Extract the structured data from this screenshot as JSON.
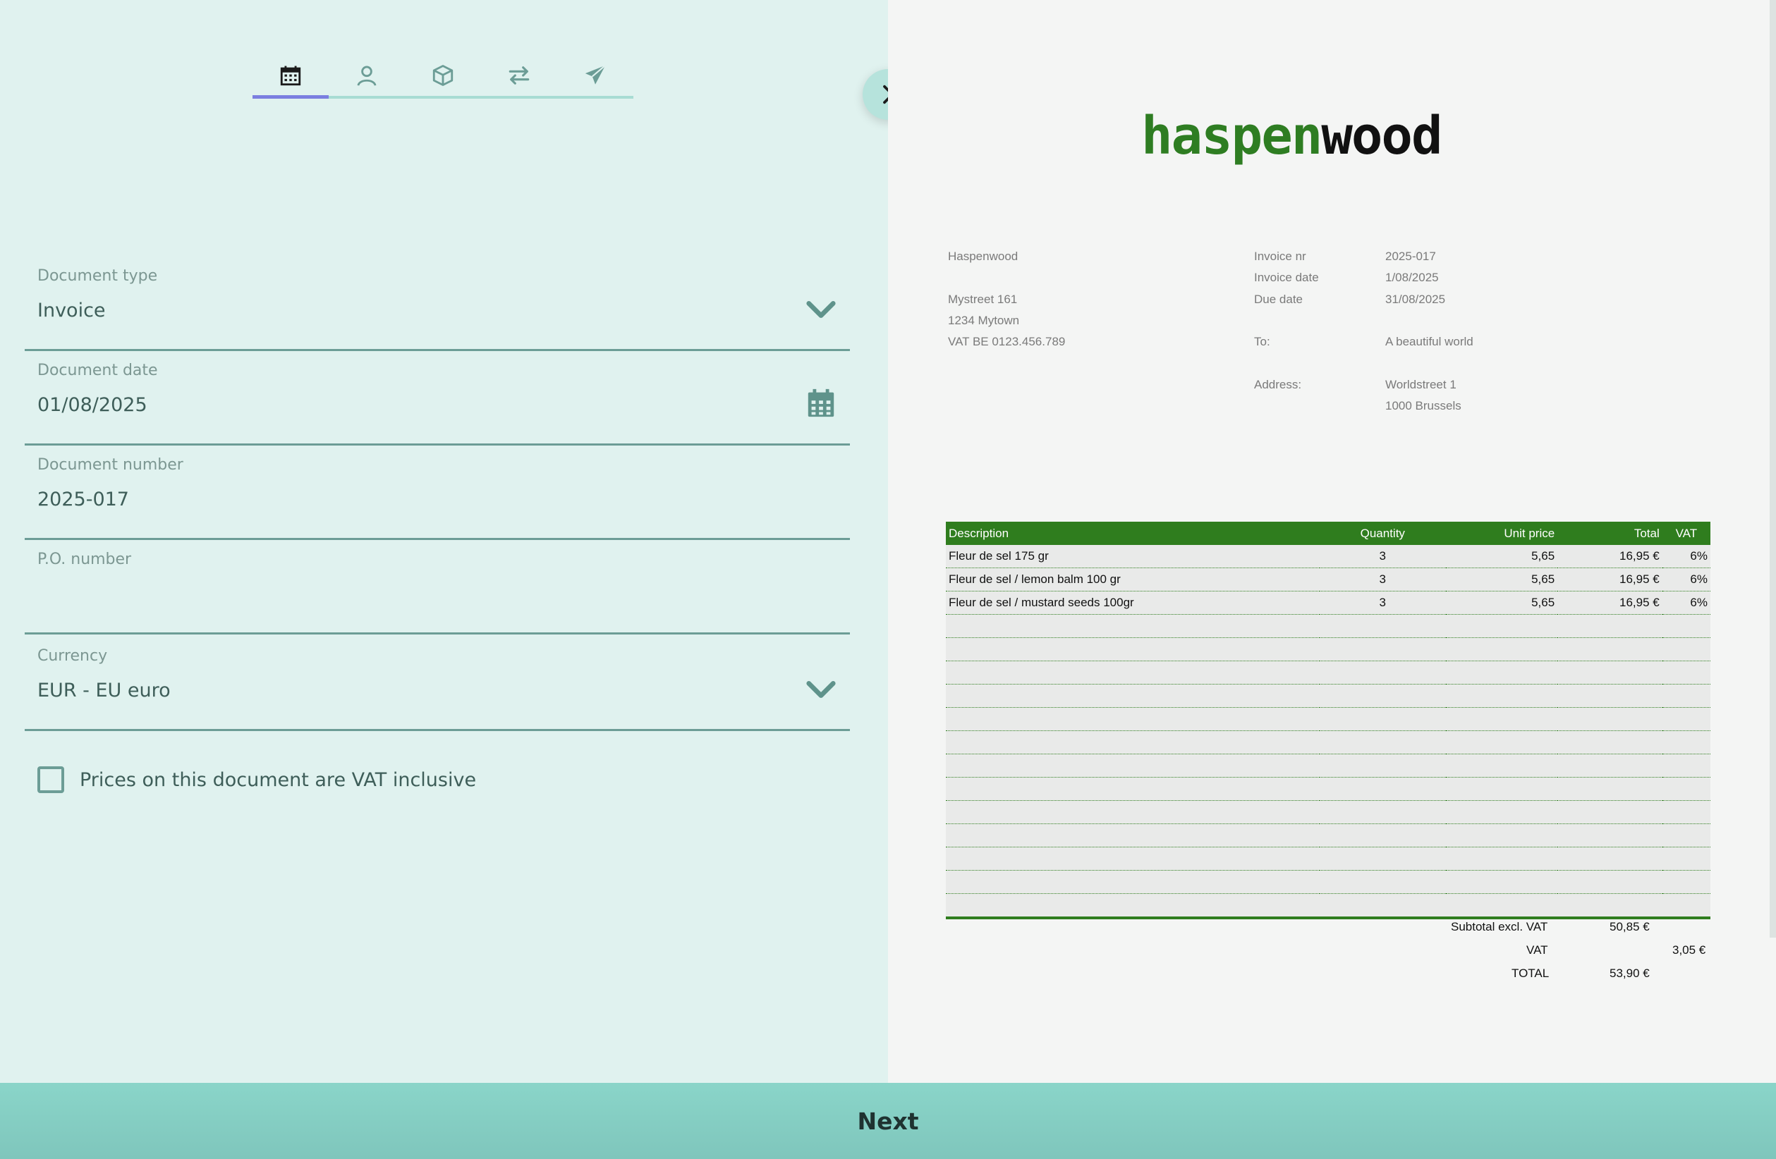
{
  "tabs": [
    {
      "name": "document",
      "icon": "calendar-icon"
    },
    {
      "name": "customer",
      "icon": "user-icon"
    },
    {
      "name": "products",
      "icon": "box-icon"
    },
    {
      "name": "transfer",
      "icon": "swap-icon"
    },
    {
      "name": "send",
      "icon": "paper-plane-icon"
    }
  ],
  "form": {
    "document_type": {
      "label": "Document type",
      "value": "Invoice"
    },
    "document_date": {
      "label": "Document date",
      "value": "01/08/2025"
    },
    "document_number": {
      "label": "Document number",
      "value": "2025-017"
    },
    "po_number": {
      "label": "P.O. number",
      "value": ""
    },
    "currency": {
      "label": "Currency",
      "value": "EUR - EU euro"
    },
    "vat_inclusive": {
      "label": "Prices on this document are VAT inclusive",
      "checked": false
    }
  },
  "preview": {
    "logo": {
      "part1": "haspen",
      "part2": "wood"
    },
    "company": {
      "name": "Haspenwood",
      "street": "Mystreet 161",
      "city": "1234 Mytown",
      "vat": "VAT BE 0123.456.789"
    },
    "invoice": {
      "nr_label": "Invoice nr",
      "nr": "2025-017",
      "date_label": "Invoice date",
      "date": "1/08/2025",
      "due_label": "Due date",
      "due": "31/08/2025",
      "to_label": "To:",
      "to": "A beautiful world",
      "address_label": "Address:",
      "address1": "Worldstreet 1",
      "address2": "1000 Brussels"
    },
    "table": {
      "headers": {
        "description": "Description",
        "quantity": "Quantity",
        "unit_price": "Unit price",
        "total": "Total",
        "vat": "VAT"
      },
      "rows": [
        {
          "description": "Fleur de sel 175 gr",
          "quantity": "3",
          "unit_price": "5,65",
          "total": "16,95 €",
          "vat": "6%"
        },
        {
          "description": "Fleur de sel / lemon balm 100 gr",
          "quantity": "3",
          "unit_price": "5,65",
          "total": "16,95 €",
          "vat": "6%"
        },
        {
          "description": "Fleur de sel / mustard seeds 100gr",
          "quantity": "3",
          "unit_price": "5,65",
          "total": "16,95 €",
          "vat": "6%"
        }
      ],
      "empty_rows": 13
    },
    "totals": {
      "subtotal_label": "Subtotal excl. VAT",
      "subtotal": "50,85 €",
      "vat_label": "VAT",
      "vat": "3,05 €",
      "total_label": "TOTAL",
      "total": "53,90 €"
    }
  },
  "footer": {
    "next_label": "Next"
  },
  "colors": {
    "accent": "#7b7fe0",
    "brand_green": "#2f7d1e",
    "teal": "#6c9d96",
    "bar": "#8ad5c9"
  }
}
